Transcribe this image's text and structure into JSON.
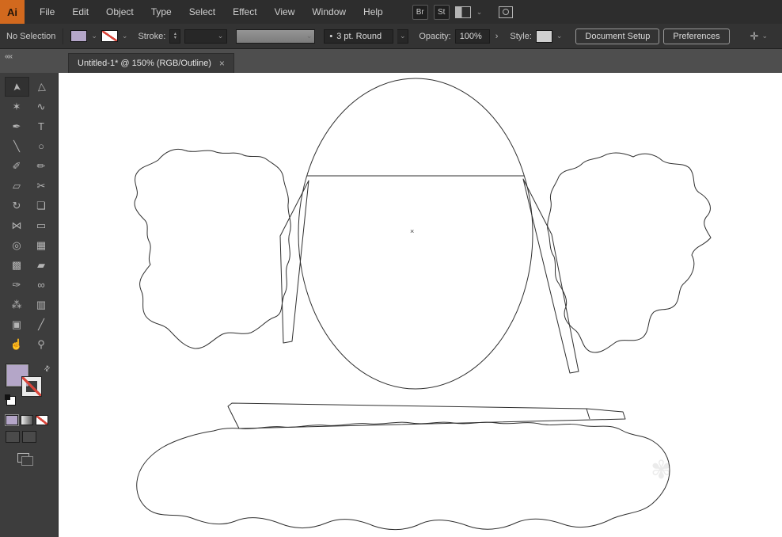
{
  "menu_bar": {
    "logo_text": "Ai",
    "items": [
      "File",
      "Edit",
      "Object",
      "Type",
      "Select",
      "Effect",
      "View",
      "Window",
      "Help"
    ],
    "br_button": "Br",
    "st_button": "St"
  },
  "control_bar": {
    "selection_status": "No Selection",
    "stroke_label": "Stroke:",
    "brush_definition": "3 pt. Round",
    "opacity_label": "Opacity:",
    "opacity_value": "100%",
    "style_label": "Style:",
    "document_setup_button": "Document Setup",
    "preferences_button": "Preferences"
  },
  "tab_bar": {
    "tab_title": "Untitled-1* @ 150% (RGB/Outline)"
  },
  "toolbar": {
    "tools": [
      {
        "name": "selection",
        "glyph": "➤"
      },
      {
        "name": "direct-selection",
        "glyph": "▷"
      },
      {
        "name": "magic-wand",
        "glyph": "✶"
      },
      {
        "name": "lasso",
        "glyph": "∿"
      },
      {
        "name": "pen",
        "glyph": "✒"
      },
      {
        "name": "type",
        "glyph": "T"
      },
      {
        "name": "line-segment",
        "glyph": "╲"
      },
      {
        "name": "ellipse",
        "glyph": "○"
      },
      {
        "name": "paintbrush",
        "glyph": "✐"
      },
      {
        "name": "pencil",
        "glyph": "✏"
      },
      {
        "name": "eraser",
        "glyph": "▱"
      },
      {
        "name": "scissors",
        "glyph": "✂"
      },
      {
        "name": "rotate",
        "glyph": "↻"
      },
      {
        "name": "scale",
        "glyph": "❏"
      },
      {
        "name": "width",
        "glyph": "⋈"
      },
      {
        "name": "free-transform",
        "glyph": "▭"
      },
      {
        "name": "shape-builder",
        "glyph": "◎"
      },
      {
        "name": "perspective-grid",
        "glyph": "▦"
      },
      {
        "name": "mesh",
        "glyph": "▩"
      },
      {
        "name": "gradient",
        "glyph": "▰"
      },
      {
        "name": "eyedropper",
        "glyph": "✑"
      },
      {
        "name": "blend",
        "glyph": "∞"
      },
      {
        "name": "symbol-sprayer",
        "glyph": "⁂"
      },
      {
        "name": "column-graph",
        "glyph": "▥"
      },
      {
        "name": "artboard",
        "glyph": "▣"
      },
      {
        "name": "slice",
        "glyph": "╱"
      },
      {
        "name": "hand",
        "glyph": "☝"
      },
      {
        "name": "zoom",
        "glyph": "⚲"
      }
    ]
  },
  "icons": {
    "dropdown": "⌄",
    "flyout": "›",
    "spinner_up": "▴",
    "spinner_down": "▾",
    "collapse": "««",
    "swap": "⇄",
    "brush_dot": "•",
    "close": "×",
    "control_panel": "✛",
    "watermark_flower": "✾"
  },
  "canvas": {
    "center_mark": "×",
    "zoom_level": "150%",
    "color_mode": "RGB/Outline"
  },
  "colors": {
    "fill_swatch": "#b4a6c8",
    "stroke_none_slash": "#d9453a",
    "logo_orange": "#d2691e",
    "outline_stroke": "#2f2f2f"
  }
}
